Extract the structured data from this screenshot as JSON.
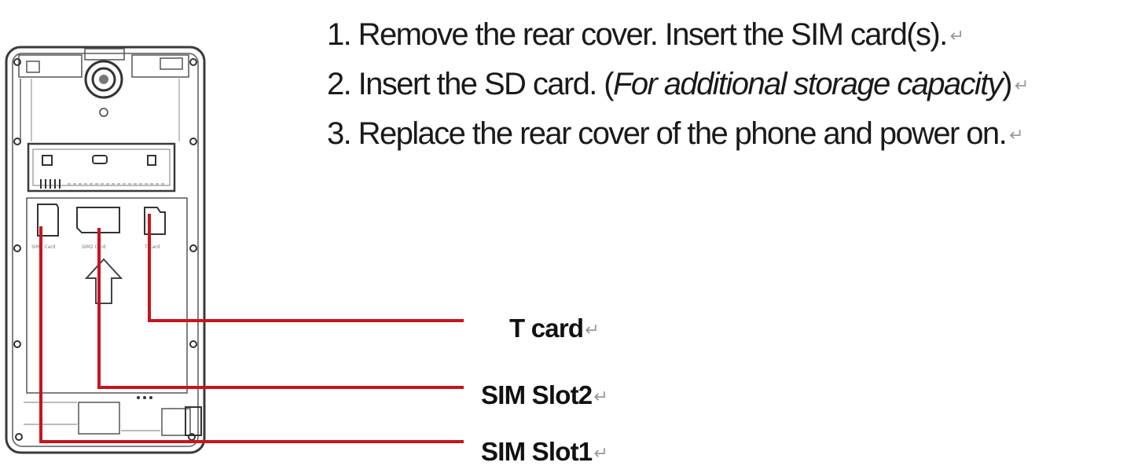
{
  "instructions": {
    "step1": "1. Remove the rear cover.  Insert the SIM card(s).",
    "step2_prefix": "2. Insert the SD card. (",
    "step2_italic": "For additional storage capacity",
    "step2_suffix": ")",
    "step3": "3. Replace the rear cover of the phone and power on.",
    "paragraph_mark": "↵"
  },
  "callouts": {
    "t_card": "T card",
    "sim_slot2": "SIM Slot2",
    "sim_slot1": "SIM Slot1"
  },
  "phone_labels": {
    "slot1": "SIM1 Card",
    "slot2": "SIM2 Card",
    "tcard": "T-Card"
  },
  "colors": {
    "leader_line": "#c8141e",
    "outline": "#3a3a3a",
    "text": "#1a1a1a"
  }
}
